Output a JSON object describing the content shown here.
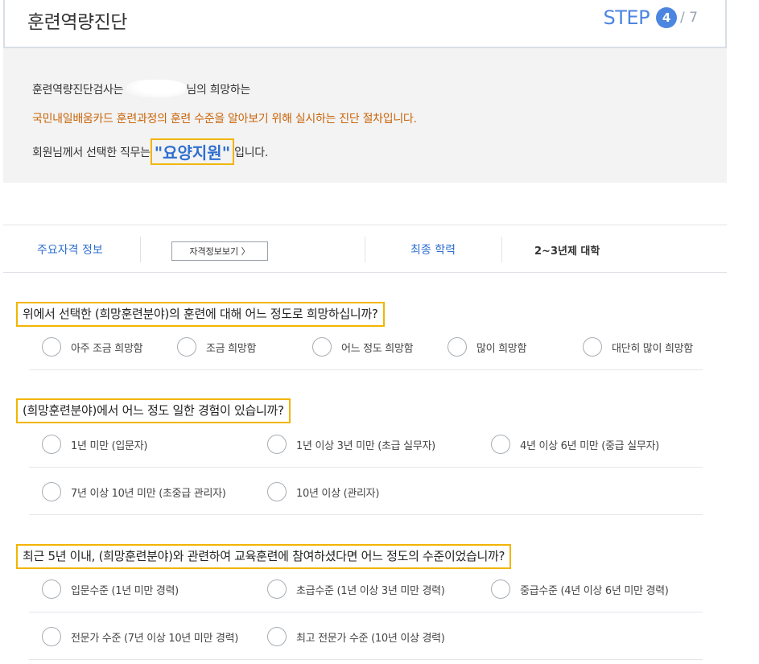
{
  "header": {
    "title": "훈련역량진단",
    "step_label": "STEP",
    "step_current": "4",
    "step_total": "/ 7"
  },
  "intro": {
    "line1_prefix": "훈련역량진단검사는",
    "line1_suffix": "님의 희망하는",
    "line2": "국민내일배움카드 훈련과정의 훈련 수준을 알아보기 위해 실시하는 진단 절차입니다.",
    "line3_prefix": "회원님께서 선택한 직무는",
    "job": "\"요양지원\"",
    "line3_suffix": "입니다."
  },
  "qualification_bar": {
    "qual_label": "주요자격 정보",
    "qual_button": "자격정보보기 〉",
    "edu_label": "최종 학력",
    "edu_value": "2~3년제 대학"
  },
  "questions": [
    {
      "text": "위에서 선택한 (희망훈련분야)의 훈련에 대해 어느 정도로 희망하십니까?",
      "options": [
        "아주 조금 희망함",
        "조금 희망함",
        "어느 정도 희망함",
        "많이 희망함",
        "대단히 많이 희망함"
      ]
    },
    {
      "text": "(희망훈련분야)에서 어느 정도 일한 경험이 있습니까?",
      "options": [
        "1년 미만 (입문자)",
        "1년 이상 3년 미만 (초급 실무자)",
        "4년 이상 6년 미만 (중급 실무자)",
        "7년 이상 10년 미만 (초중급 관리자)",
        "10년 이상 (관리자)"
      ]
    },
    {
      "text": "최근 5년 이내, (희망훈련분야)와 관련하여 교육훈련에 참여하셨다면 어느 정도의 수준이었습니까?",
      "options": [
        "입문수준 (1년 미만 경력)",
        "초급수준 (1년 이상 3년 미만 경력)",
        "중급수준 (4년 이상 6년 미만 경력)",
        "전문가 수준 (7년 이상 10년 미만 경력)",
        "최고 전문가 수준 (10년 이상 경력)"
      ]
    }
  ],
  "colors": {
    "accent_blue": "#4c86e0",
    "link_blue": "#2f6fd0",
    "highlight_yellow": "#f2b500",
    "notice_orange": "#c9650a"
  }
}
